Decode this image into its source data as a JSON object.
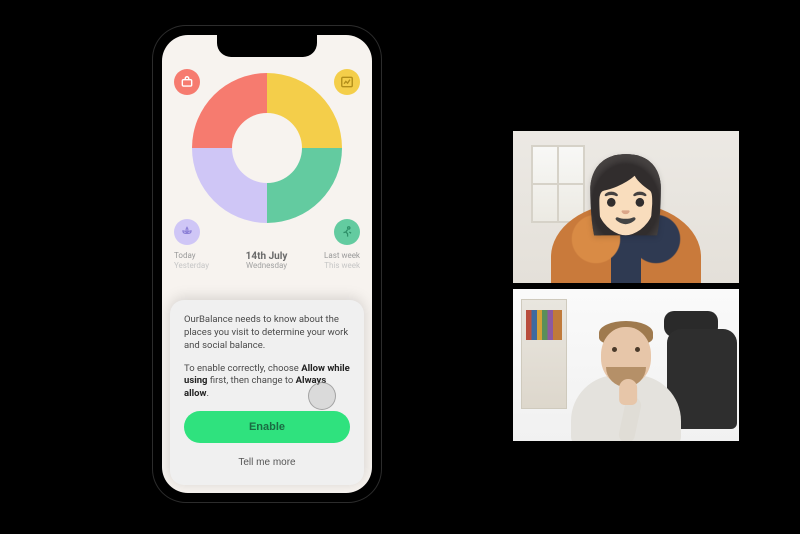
{
  "phone": {
    "date": {
      "left_top": "Today",
      "left_bottom": "Yesterday",
      "main": "14th July",
      "sub": "Wednesday",
      "right_top": "Last week",
      "right_bottom": "This week"
    },
    "categories": {
      "top_left": {
        "name": "work-icon",
        "color": "#f67b6f"
      },
      "top_right": {
        "name": "chart-icon",
        "color": "#f4ce4a"
      },
      "bottom_left": {
        "name": "lotus-icon",
        "color": "#cfc6f6"
      },
      "bottom_right": {
        "name": "running-icon",
        "color": "#63cba0"
      }
    },
    "sheet": {
      "text1": "OurBalance needs to know about the places you visit to determine your work and social balance.",
      "text2_a": "To enable correctly, choose ",
      "text2_b": "Allow while using",
      "text2_c": " first, then change to ",
      "text2_d": "Always allow",
      "text2_e": ".",
      "enable_label": "Enable",
      "more_label": "Tell me more"
    }
  },
  "chart_data": {
    "type": "pie",
    "title": "",
    "categories": [
      "Work",
      "Finance",
      "Wellness",
      "Activity"
    ],
    "values": [
      25,
      25,
      25,
      25
    ],
    "series_colors": [
      "#f67b6f",
      "#f4ce4a",
      "#63cba0",
      "#cfc6f6"
    ]
  },
  "video": {
    "participant1": {
      "name": "participant-memoji"
    },
    "participant2": {
      "name": "participant-person"
    }
  }
}
